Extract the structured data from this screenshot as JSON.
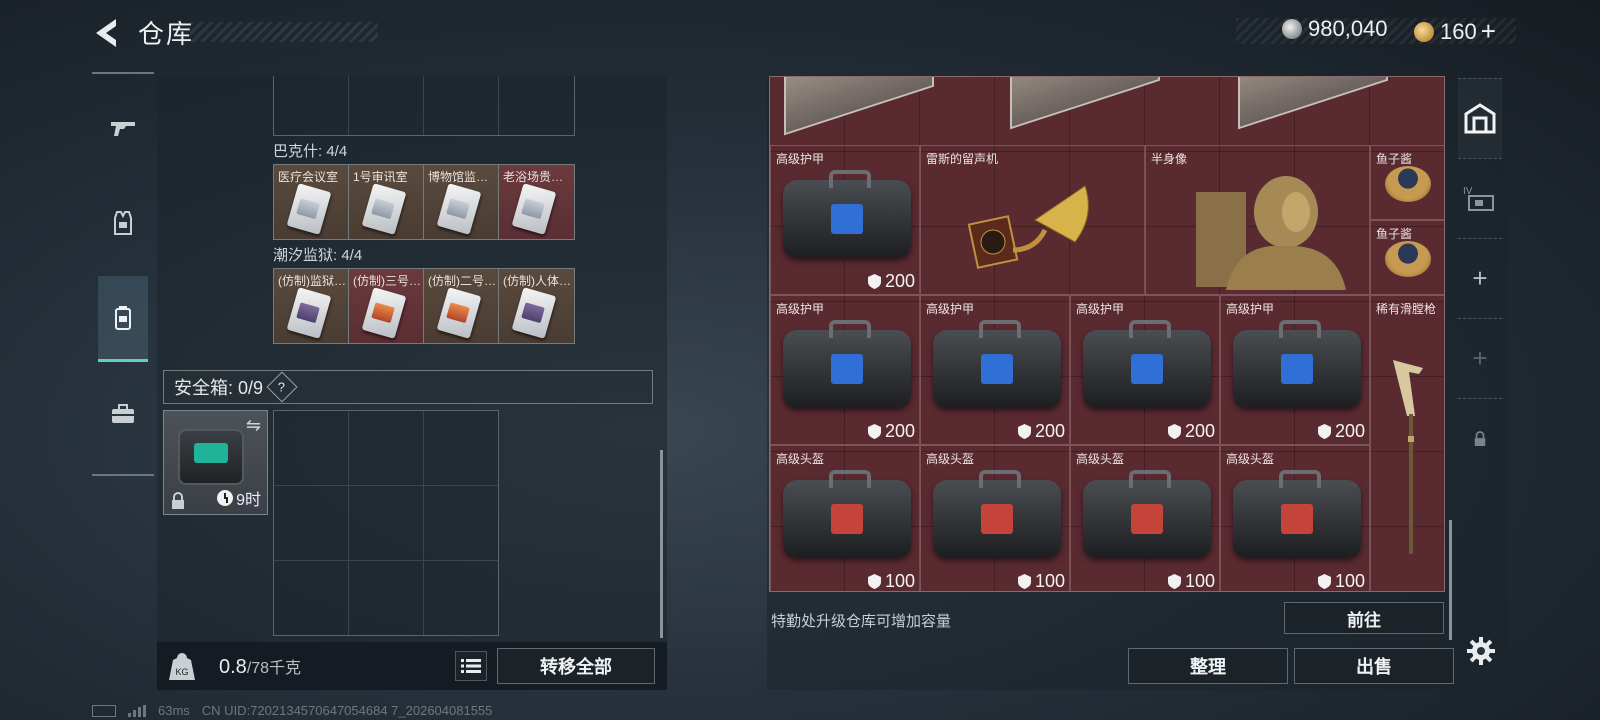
{
  "header": {
    "title": "仓库",
    "currency_silver": "980,040",
    "currency_gold": "160"
  },
  "left_nav": {
    "items": [
      {
        "icon": "gun-icon",
        "active": false
      },
      {
        "icon": "vest-icon",
        "active": false
      },
      {
        "icon": "backpack-icon",
        "active": true
      },
      {
        "icon": "briefcase-icon",
        "active": false
      }
    ]
  },
  "left_panel": {
    "section_bakeshi": {
      "label": "巴克什: 4/4",
      "cards": [
        "医疗会议室",
        "1号审讯室",
        "博物馆监控室",
        "老浴场贵宾室"
      ]
    },
    "section_chaoxi": {
      "label": "潮汐监狱: 4/4",
      "cards": [
        "(仿制)监狱入口",
        "(仿制)三号审讯室",
        "(仿制)二号审讯室",
        "(仿制)人体实验室"
      ]
    },
    "safebox": {
      "label": "安全箱: 0/9",
      "help": "?",
      "timer": "9时"
    },
    "weight": {
      "current": "0.8",
      "max": "/78千克",
      "kg_label": "KG"
    },
    "transfer_all": "转移全部"
  },
  "right_panel": {
    "items": {
      "armor_a": {
        "name": "高级护甲",
        "durability": "200"
      },
      "gramophone": {
        "name": "雷斯的留声机"
      },
      "bust": {
        "name": "半身像"
      },
      "caviar_1": {
        "name": "鱼子酱"
      },
      "caviar_2": {
        "name": "鱼子酱"
      },
      "armor_b1": {
        "name": "高级护甲",
        "durability": "200"
      },
      "armor_b2": {
        "name": "高级护甲",
        "durability": "200"
      },
      "armor_b3": {
        "name": "高级护甲",
        "durability": "200"
      },
      "armor_b4": {
        "name": "高级护甲",
        "durability": "200"
      },
      "rifle": {
        "name": "稀有滑膛枪"
      },
      "helmet_1": {
        "name": "高级头盔",
        "durability": "100"
      },
      "helmet_2": {
        "name": "高级头盔",
        "durability": "100"
      },
      "helmet_3": {
        "name": "高级头盔",
        "durability": "100"
      },
      "helmet_4": {
        "name": "高级头盔",
        "durability": "100"
      }
    },
    "upgrade_hint": "特勤处升级仓库可增加容量",
    "goto_label": "前往",
    "sort_label": "整理",
    "sell_label": "出售"
  },
  "right_tabs": {
    "plus_1": "+",
    "plus_2": "+"
  },
  "footer": {
    "ping": "63ms",
    "uid": "CN UID:7202134570647054684 7_202604081555"
  }
}
